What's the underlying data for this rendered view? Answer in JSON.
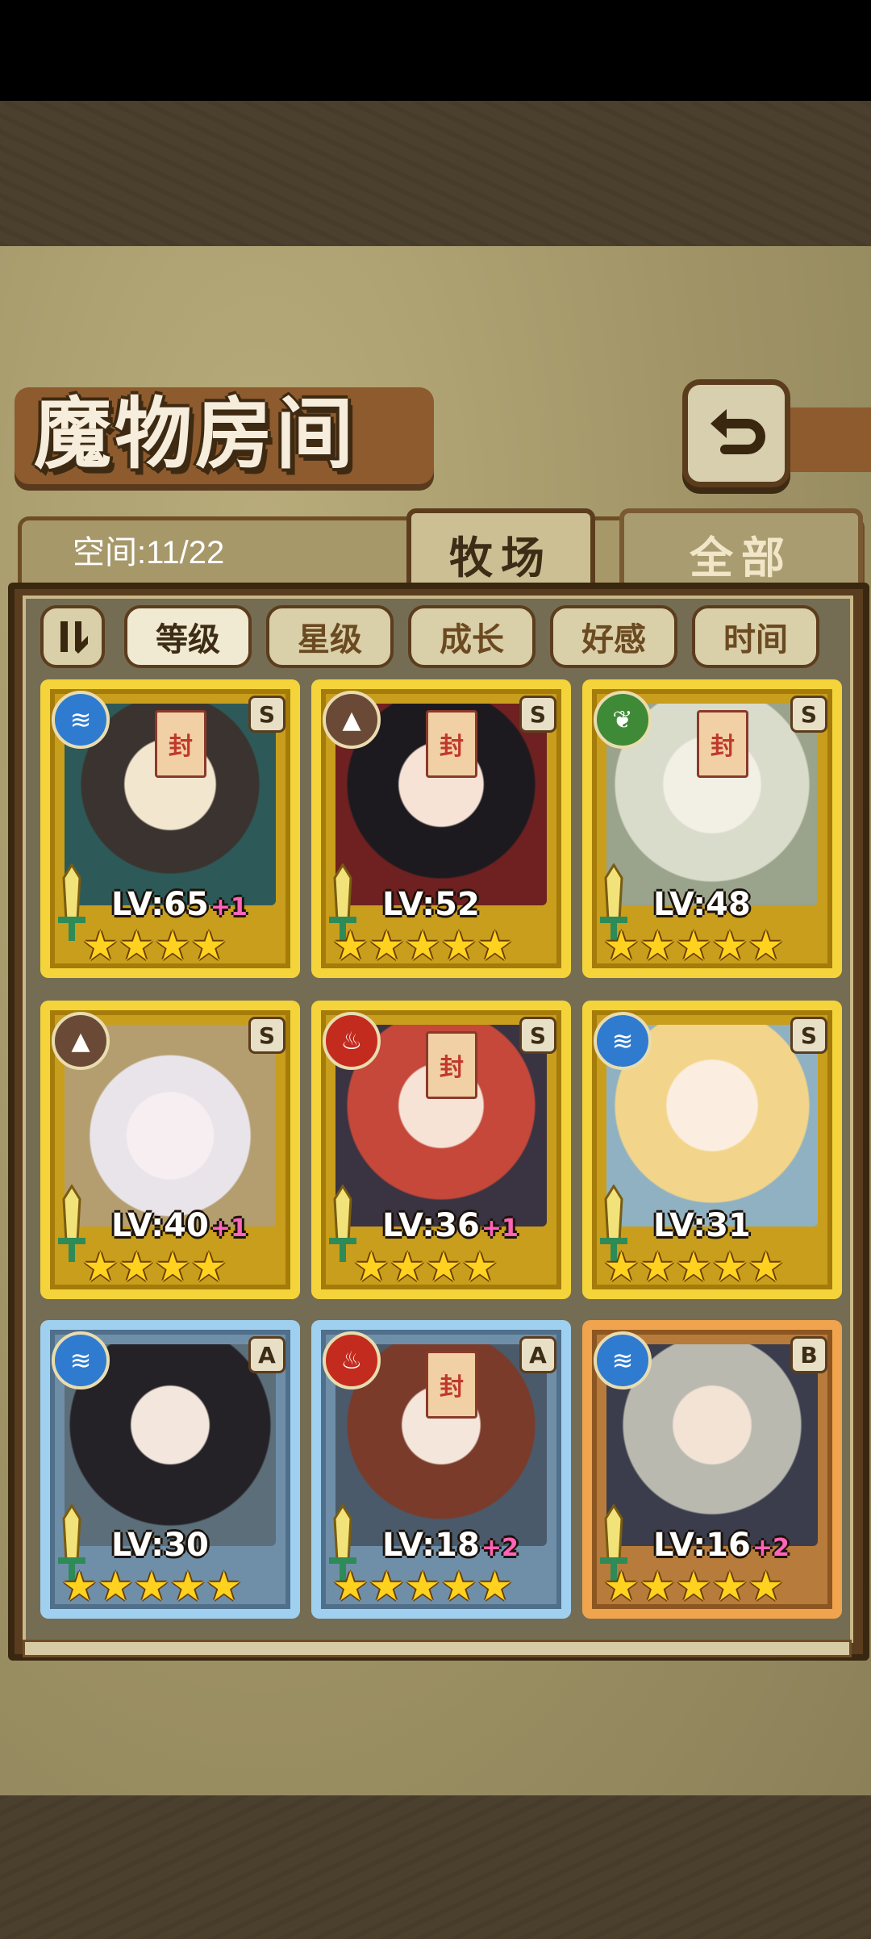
{
  "title": "魔物房间",
  "space": "空间:11/22",
  "tabs": [
    {
      "label": "牧场",
      "active": true
    },
    {
      "label": "全部",
      "active": false
    }
  ],
  "sort_buttons": [
    {
      "label": "等级",
      "active": true
    },
    {
      "label": "星级",
      "active": false
    },
    {
      "label": "成长",
      "active": false
    },
    {
      "label": "好感",
      "active": false
    },
    {
      "label": "时间",
      "active": false
    }
  ],
  "monsters": [
    {
      "level": "LV:65",
      "bonus": "+1",
      "rank": "S",
      "stars": "★★★★",
      "element": "water-icon",
      "frame": "gold",
      "sealed": true
    },
    {
      "level": "LV:52",
      "bonus": "",
      "rank": "S",
      "stars": "★★★★★",
      "element": "earth-icon",
      "frame": "gold",
      "sealed": true
    },
    {
      "level": "LV:48",
      "bonus": "",
      "rank": "S",
      "stars": "★★★★★",
      "element": "leaf-icon",
      "frame": "gold",
      "sealed": true
    },
    {
      "level": "LV:40",
      "bonus": "+1",
      "rank": "S",
      "stars": "★★★★",
      "element": "earth-icon",
      "frame": "gold",
      "sealed": false
    },
    {
      "level": "LV:36",
      "bonus": "+1",
      "rank": "S",
      "stars": "★★★★",
      "element": "fire-icon",
      "frame": "gold",
      "sealed": true
    },
    {
      "level": "LV:31",
      "bonus": "",
      "rank": "S",
      "stars": "★★★★★",
      "element": "water-icon",
      "frame": "gold",
      "sealed": false
    },
    {
      "level": "LV:30",
      "bonus": "",
      "rank": "A",
      "stars": "★★★★★",
      "element": "water-icon",
      "frame": "silver",
      "sealed": false
    },
    {
      "level": "LV:18",
      "bonus": "+2",
      "rank": "A",
      "stars": "★★★★★",
      "element": "fire-icon",
      "frame": "silver",
      "sealed": true
    },
    {
      "level": "LV:16",
      "bonus": "+2",
      "rank": "B",
      "stars": "★★★★★",
      "element": "water-icon",
      "frame": "bronze",
      "sealed": false
    }
  ],
  "colors": {
    "water": "#2f7bd0",
    "earth": "#6a4a36",
    "leaf": "#3f8a37",
    "fire": "#c32b1f",
    "accent_gold": "#f4d43a"
  }
}
